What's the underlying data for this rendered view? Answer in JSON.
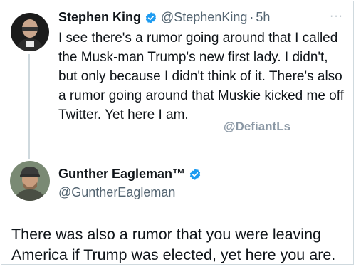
{
  "watermark": "@DefiantLs",
  "tweet1": {
    "name": "Stephen King",
    "handle": "@StephenKing",
    "separator": "·",
    "time": "5h",
    "more_icon": "···",
    "avatar_icon": "avatar-stephen-king",
    "text": "I see there's a rumor going around that I called the Musk-man Trump's new first lady. I didn't, but only because I didn't think of it. There's also a rumor going around that Muskie kicked me off Twitter. Yet here I am."
  },
  "tweet2": {
    "name": "Gunther Eagleman™",
    "handle": "@GuntherEagleman",
    "avatar_icon": "avatar-gunther-eagleman",
    "text": "There was also a rumor that you were leaving America if Trump was elected, yet here you are."
  },
  "colors": {
    "verified_blue": "#1d9bf0",
    "secondary_text": "#536471",
    "primary_text": "#0f1419",
    "thread_line": "#cfd9de"
  }
}
